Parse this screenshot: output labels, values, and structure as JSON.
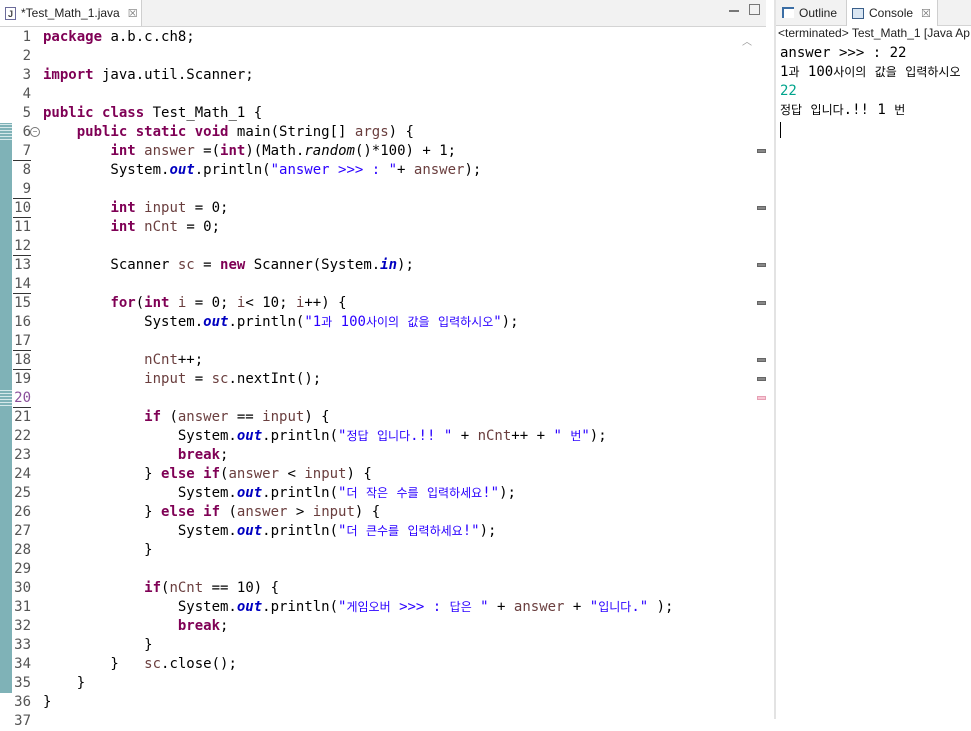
{
  "editor_tab": {
    "title": "*Test_Math_1.java",
    "icon": "java-file-icon",
    "close": "☒"
  },
  "views": {
    "outline_label": "Outline",
    "console_label": "Console",
    "close": "☒"
  },
  "console_header": "<terminated> Test_Math_1 [Java Ap",
  "console_output": [
    "answer >>> : 22",
    "1과 100사이의 값을 입력하시오",
    "22",
    "정답 입니다.!! 1 번"
  ],
  "code_lines": [
    {
      "n": "1",
      "t": "package a.b.c.ch8;"
    },
    {
      "n": "2",
      "t": ""
    },
    {
      "n": "3",
      "t": "import java.util.Scanner;"
    },
    {
      "n": "4",
      "t": ""
    },
    {
      "n": "5",
      "t": "public class Test_Math_1 {"
    },
    {
      "n": "6",
      "t": "    public static void main(String[] args) {"
    },
    {
      "n": "7",
      "t": "        int answer =(int)(Math.random()*100) + 1;"
    },
    {
      "n": "8",
      "t": "        System.out.println(\"answer >>> : \"+ answer);"
    },
    {
      "n": "9",
      "t": ""
    },
    {
      "n": "10",
      "t": "        int input = 0;"
    },
    {
      "n": "11",
      "t": "        int nCnt = 0;"
    },
    {
      "n": "12",
      "t": ""
    },
    {
      "n": "13",
      "t": "        Scanner sc = new Scanner(System.in);"
    },
    {
      "n": "14",
      "t": ""
    },
    {
      "n": "15",
      "t": "        for(int i = 0; i< 10; i++) {"
    },
    {
      "n": "16",
      "t": "            System.out.println(\"1과 100사이의 값을 입력하시오\");"
    },
    {
      "n": "17",
      "t": ""
    },
    {
      "n": "18",
      "t": "            nCnt++;"
    },
    {
      "n": "19",
      "t": "            input = sc.nextInt();"
    },
    {
      "n": "20",
      "t": ""
    },
    {
      "n": "21",
      "t": "            if (answer == input) {"
    },
    {
      "n": "22",
      "t": "                System.out.println(\"정답 입니다.!! \" + nCnt++ + \" 번\");"
    },
    {
      "n": "23",
      "t": "                break;"
    },
    {
      "n": "24",
      "t": "            } else if(answer < input) {"
    },
    {
      "n": "25",
      "t": "                System.out.println(\"더 작은 수를 입력하세요!\");"
    },
    {
      "n": "26",
      "t": "            } else if (answer > input) {"
    },
    {
      "n": "27",
      "t": "                System.out.println(\"더 큰수를 입력하세요!\");"
    },
    {
      "n": "28",
      "t": "            }"
    },
    {
      "n": "29",
      "t": ""
    },
    {
      "n": "30",
      "t": "            if(nCnt == 10) {"
    },
    {
      "n": "31",
      "t": "                System.out.println(\"게임오버 >>> : 답은 \" + answer + \"입니다.\" );"
    },
    {
      "n": "32",
      "t": "                break;"
    },
    {
      "n": "33",
      "t": "            }"
    },
    {
      "n": "34",
      "t": "        }   sc.close();"
    },
    {
      "n": "35",
      "t": "    }"
    },
    {
      "n": "36",
      "t": "}"
    },
    {
      "n": "37",
      "t": ""
    }
  ],
  "colors": {
    "keyword": "#7f0055",
    "string": "#2a00ff",
    "field": "#0000c0",
    "local_var": "#6a3e3e",
    "change_bar": "#7fb2b7",
    "console_input": "#00a48c"
  }
}
